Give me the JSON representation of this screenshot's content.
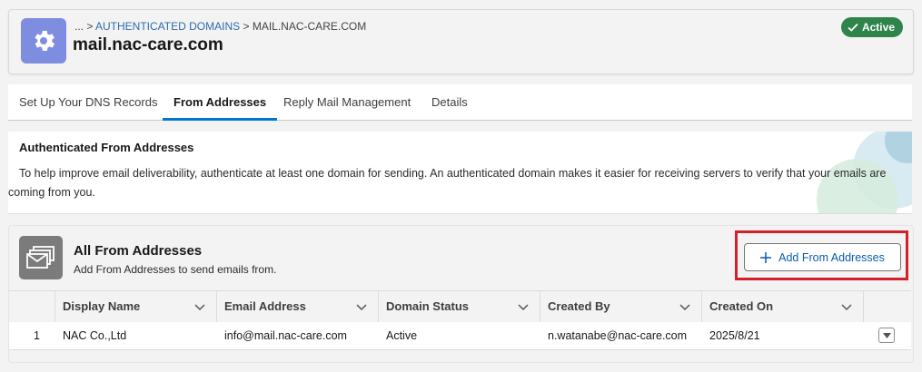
{
  "header": {
    "breadcrumb_ellipsis": "... >",
    "breadcrumb_link": "AUTHENTICATED DOMAINS",
    "breadcrumb_sep": ">",
    "breadcrumb_current": "MAIL.NAC-CARE.COM",
    "title": "mail.nac-care.com",
    "status_badge": "Active",
    "icon": "gear-icon"
  },
  "tabs": [
    {
      "label": "Set Up Your DNS Records"
    },
    {
      "label": "From Addresses",
      "active": true
    },
    {
      "label": "Reply Mail Management"
    },
    {
      "label": "Details"
    }
  ],
  "info": {
    "title": "Authenticated From Addresses",
    "text": "To help improve email deliverability, authenticate at least one domain for sending. An authenticated domain makes it easier for receiving servers to verify that your emails are coming from you."
  },
  "list": {
    "title": "All From Addresses",
    "subtitle": "Add From Addresses to send emails from.",
    "add_button": "Add From Addresses",
    "columns": [
      "Display Name",
      "Email Address",
      "Domain Status",
      "Created By",
      "Created On"
    ],
    "rows": [
      {
        "num": "1",
        "display_name": "NAC Co.,Ltd",
        "email": "info@mail.nac-care.com",
        "status": "Active",
        "created_by": "n.watanabe@nac-care.com",
        "created_on": "2025/8/21"
      }
    ]
  },
  "colors": {
    "accent": "#0176d3",
    "badge": "#2e844a",
    "highlight": "#d4202a",
    "app_icon": "#7f8de1"
  }
}
